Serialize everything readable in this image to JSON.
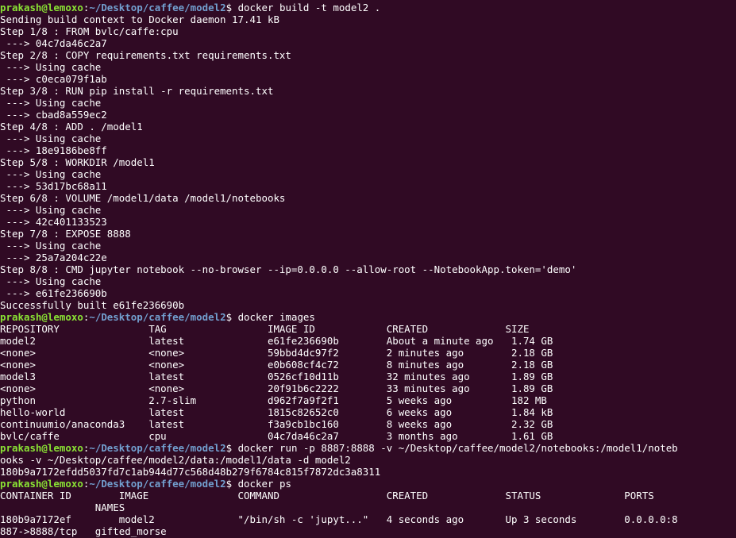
{
  "colors": {
    "background": "#300a24",
    "text": "#ffffff",
    "prompt_user": "#8ae234",
    "prompt_path": "#729fcf"
  },
  "prompt": {
    "user_host": "prakash@lemoxo",
    "path": "~/Desktop/caffee/model2"
  },
  "lines": [
    {
      "type": "prompt",
      "command": "docker build -t model2 ."
    },
    {
      "type": "output",
      "text": "Sending build context to Docker daemon 17.41 kB"
    },
    {
      "type": "output",
      "text": "Step 1/8 : FROM bvlc/caffe:cpu"
    },
    {
      "type": "output",
      "text": " ---> 04c7da46c2a7"
    },
    {
      "type": "output",
      "text": "Step 2/8 : COPY requirements.txt requirements.txt"
    },
    {
      "type": "output",
      "text": " ---> Using cache"
    },
    {
      "type": "output",
      "text": " ---> c0eca079f1ab"
    },
    {
      "type": "output",
      "text": "Step 3/8 : RUN pip install -r requirements.txt"
    },
    {
      "type": "output",
      "text": " ---> Using cache"
    },
    {
      "type": "output",
      "text": " ---> cbad8a559ec2"
    },
    {
      "type": "output",
      "text": "Step 4/8 : ADD . /model1"
    },
    {
      "type": "output",
      "text": " ---> Using cache"
    },
    {
      "type": "output",
      "text": " ---> 18e9186be8ff"
    },
    {
      "type": "output",
      "text": "Step 5/8 : WORKDIR /model1"
    },
    {
      "type": "output",
      "text": " ---> Using cache"
    },
    {
      "type": "output",
      "text": " ---> 53d17bc68a11"
    },
    {
      "type": "output",
      "text": "Step 6/8 : VOLUME /model1/data /model1/notebooks"
    },
    {
      "type": "output",
      "text": " ---> Using cache"
    },
    {
      "type": "output",
      "text": " ---> 42c401133523"
    },
    {
      "type": "output",
      "text": "Step 7/8 : EXPOSE 8888"
    },
    {
      "type": "output",
      "text": " ---> Using cache"
    },
    {
      "type": "output",
      "text": " ---> 25a7a204c22e"
    },
    {
      "type": "output",
      "text": "Step 8/8 : CMD jupyter notebook --no-browser --ip=0.0.0.0 --allow-root --NotebookApp.token='demo'"
    },
    {
      "type": "output",
      "text": " ---> Using cache"
    },
    {
      "type": "output",
      "text": " ---> e61fe236690b"
    },
    {
      "type": "output",
      "text": "Successfully built e61fe236690b"
    },
    {
      "type": "prompt",
      "command": "docker images"
    },
    {
      "type": "output",
      "text": "REPOSITORY               TAG                 IMAGE ID            CREATED             SIZE"
    },
    {
      "type": "output",
      "text": "model2                   latest              e61fe236690b        About a minute ago   1.74 GB"
    },
    {
      "type": "output",
      "text": "<none>                   <none>              59bbd4dc97f2        2 minutes ago        2.18 GB"
    },
    {
      "type": "output",
      "text": "<none>                   <none>              e0b608cf4c72        8 minutes ago        2.18 GB"
    },
    {
      "type": "output",
      "text": "model3                   latest              0526cf10d11b        32 minutes ago       1.89 GB"
    },
    {
      "type": "output",
      "text": "<none>                   <none>              20f91b6c2222        33 minutes ago       1.89 GB"
    },
    {
      "type": "output",
      "text": "python                   2.7-slim            d962f7a9f2f1        5 weeks ago          182 MB"
    },
    {
      "type": "output",
      "text": "hello-world              latest              1815c82652c0        6 weeks ago          1.84 kB"
    },
    {
      "type": "output",
      "text": "continuumio/anaconda3    latest              f3a9cb1bc160        8 weeks ago          2.32 GB"
    },
    {
      "type": "output",
      "text": "bvlc/caffe               cpu                 04c7da46c2a7        3 months ago         1.61 GB"
    },
    {
      "type": "prompt",
      "command": "docker run -p 8887:8888 -v ~/Desktop/caffee/model2/notebooks:/model1/noteb"
    },
    {
      "type": "output",
      "text": "ooks -v ~/Desktop/caffee/model2/data:/model1/data -d model2"
    },
    {
      "type": "output",
      "text": "180b9a7172efdd5037fd7c1ab944d77c568d48b279f6784c815f7872dc3a8311"
    },
    {
      "type": "prompt",
      "command": "docker ps"
    },
    {
      "type": "output",
      "text": "CONTAINER ID        IMAGE               COMMAND                  CREATED             STATUS              PORTS"
    },
    {
      "type": "output",
      "text": "                NAMES"
    },
    {
      "type": "output",
      "text": "180b9a7172ef        model2              \"/bin/sh -c 'jupyt...\"   4 seconds ago       Up 3 seconds        0.0.0.0:8"
    },
    {
      "type": "output",
      "text": "887->8888/tcp   gifted_morse"
    }
  ]
}
